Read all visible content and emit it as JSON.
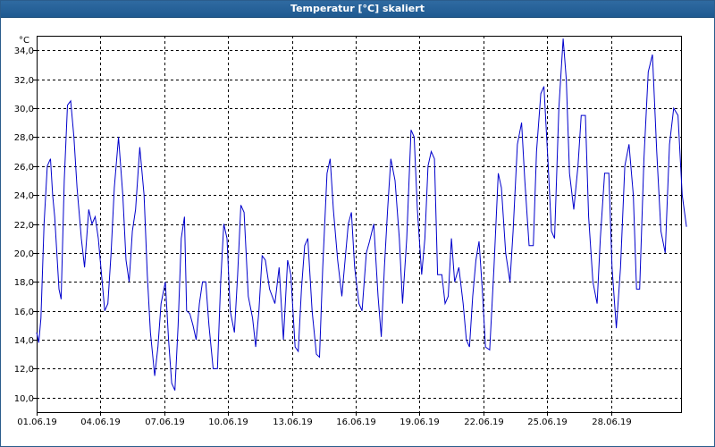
{
  "window": {
    "title": "Temperatur [°C] skaliert"
  },
  "chart_data": {
    "type": "line",
    "title": "Temperatur [°C] skaliert",
    "ylabel": "°C",
    "xlabel": "",
    "xlim": [
      "01.06.19",
      "02.07.19"
    ],
    "ylim": [
      9.0,
      35.0
    ],
    "y_ticks": [
      "10,0",
      "12,0",
      "14,0",
      "16,0",
      "18,0",
      "20,0",
      "22,0",
      "24,0",
      "26,0",
      "28,0",
      "30,0",
      "32,0",
      "34,0"
    ],
    "x_ticks": [
      "01.06.19",
      "04.06.19",
      "07.06.19",
      "10.06.19",
      "13.06.19",
      "16.06.19",
      "19.06.19",
      "22.06.19",
      "25.06.19",
      "28.06.19"
    ],
    "grid": true,
    "line_color": "#0000cc",
    "series": [
      {
        "name": "",
        "x_days": [
          0,
          0.1,
          0.2,
          0.35,
          0.5,
          0.65,
          0.75,
          0.85,
          1.05,
          1.15,
          1.3,
          1.45,
          1.6,
          1.75,
          1.9,
          2.1,
          2.25,
          2.45,
          2.6,
          2.75,
          2.9,
          3.05,
          3.2,
          3.35,
          3.5,
          3.65,
          3.85,
          4.05,
          4.2,
          4.35,
          4.5,
          4.65,
          4.85,
          5.05,
          5.2,
          5.35,
          5.55,
          5.7,
          5.85,
          6.05,
          6.2,
          6.35,
          6.5,
          6.65,
          6.8,
          6.95,
          7.05,
          7.2,
          7.35,
          7.5,
          7.65,
          7.8,
          7.95,
          8.1,
          8.3,
          8.5,
          8.65,
          8.8,
          8.95,
          9.1,
          9.3,
          9.45,
          9.6,
          9.75,
          9.95,
          10.15,
          10.3,
          10.45,
          10.6,
          10.75,
          10.95,
          11.2,
          11.4,
          11.6,
          11.8,
          11.95,
          12.15,
          12.3,
          12.45,
          12.6,
          12.75,
          12.95,
          13.15,
          13.3,
          13.45,
          13.65,
          13.8,
          13.95,
          14.15,
          14.35,
          14.5,
          14.65,
          14.8,
          14.95,
          15.15,
          15.3,
          15.5,
          15.65,
          15.85,
          16.05,
          16.2,
          16.35,
          16.5,
          16.65,
          16.85,
          17.05,
          17.2,
          17.4,
          17.6,
          17.75,
          17.9,
          18.1,
          18.25,
          18.4,
          18.55,
          18.7,
          18.85,
          19.05,
          19.2,
          19.35,
          19.5,
          19.65,
          19.85,
          20.05,
          20.2,
          20.35,
          20.5,
          20.65,
          20.8,
          20.95,
          21.1,
          21.3,
          21.5,
          21.7,
          21.85,
          22.05,
          22.25,
          22.4,
          22.6,
          22.8,
          22.95,
          23.15,
          23.35,
          23.5,
          23.7,
          23.85,
          24.05,
          24.2,
          24.35,
          24.55,
          24.75,
          24.9,
          25.05,
          25.25,
          25.45,
          25.6,
          25.8,
          25.95,
          26.15,
          26.35,
          26.5,
          26.7,
          26.9,
          27.05,
          27.25,
          27.45,
          27.65,
          27.85,
          28.05,
          28.2,
          28.35,
          28.55,
          28.75,
          28.95,
          29.15,
          29.35,
          29.55,
          29.75,
          29.95,
          30.15,
          30.35,
          30.55,
          30.75,
          30.85
        ],
        "values": [
          14.5,
          13.8,
          15.5,
          22.0,
          26.0,
          26.5,
          24.0,
          22.5,
          17.5,
          16.8,
          25.0,
          30.2,
          30.5,
          28.0,
          24.5,
          21.0,
          19.0,
          23.0,
          22.0,
          22.5,
          21.0,
          18.5,
          16.0,
          16.5,
          20.0,
          24.5,
          28.0,
          24.0,
          19.5,
          18.0,
          21.5,
          23.0,
          27.3,
          24.0,
          18.5,
          14.5,
          11.5,
          13.5,
          16.5,
          18.0,
          14.0,
          11.0,
          10.5,
          15.0,
          21.0,
          22.5,
          16.0,
          15.8,
          15.0,
          14.0,
          16.5,
          18.0,
          18.0,
          15.0,
          12.0,
          12.0,
          18.0,
          22.0,
          21.0,
          16.0,
          14.5,
          18.5,
          23.3,
          22.8,
          17.0,
          15.5,
          13.5,
          16.0,
          19.8,
          19.5,
          17.5,
          16.5,
          19.0,
          14.0,
          19.5,
          18.5,
          13.5,
          13.2,
          17.5,
          20.5,
          21.0,
          16.0,
          13.0,
          12.8,
          19.0,
          25.5,
          26.5,
          23.0,
          19.5,
          17.0,
          19.5,
          22.0,
          22.8,
          19.0,
          16.5,
          16.0,
          20.0,
          20.8,
          22.0,
          17.0,
          14.2,
          19.0,
          23.0,
          26.5,
          25.0,
          21.0,
          16.5,
          21.0,
          28.5,
          28.0,
          23.0,
          18.5,
          21.0,
          26.0,
          27.0,
          26.5,
          18.5,
          18.5,
          16.5,
          17.0,
          21.0,
          18.0,
          19.0,
          16.5,
          14.0,
          13.5,
          17.0,
          19.5,
          20.8,
          17.5,
          13.5,
          13.3,
          19.0,
          25.5,
          24.5,
          20.0,
          18.0,
          21.5,
          27.5,
          29.0,
          25.0,
          20.5,
          20.5,
          27.0,
          31.0,
          31.5,
          26.0,
          21.5,
          21.0,
          30.0,
          34.8,
          32.0,
          25.5,
          23.0,
          26.0,
          29.5,
          29.5,
          22.5,
          18.0,
          16.5,
          21.0,
          25.5,
          25.5,
          19.0,
          14.8,
          19.0,
          26.0,
          27.5,
          24.0,
          17.5,
          17.5,
          26.5,
          32.5,
          33.7,
          27.0,
          21.5,
          20.0,
          27.5,
          30.0,
          29.5,
          24.0,
          21.8
        ]
      }
    ]
  }
}
